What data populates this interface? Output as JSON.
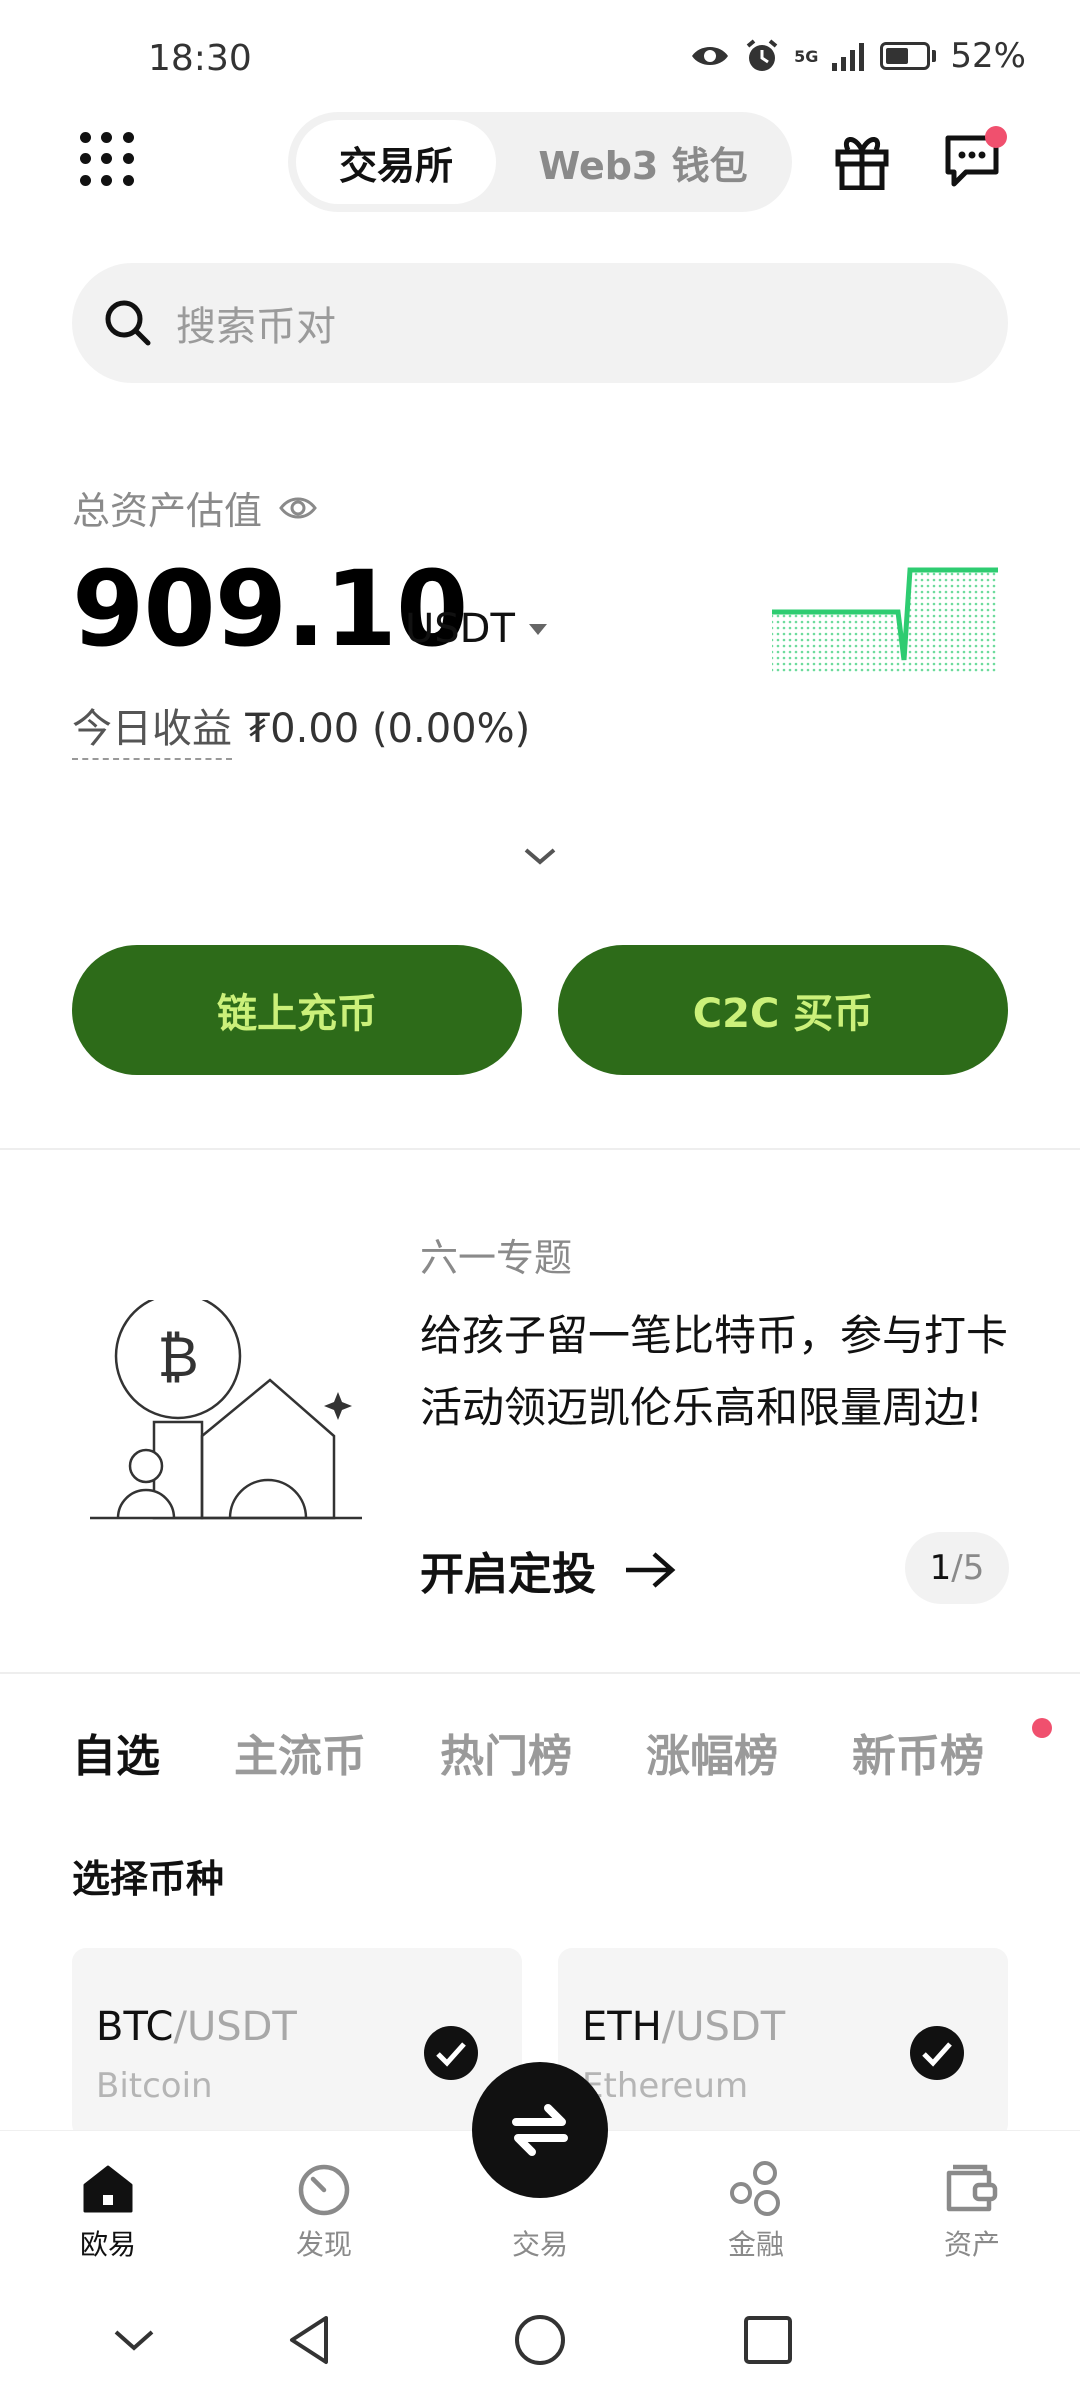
{
  "status_bar": {
    "time": "18:30",
    "network": "5G",
    "battery": "52%"
  },
  "header": {
    "tabs": [
      {
        "label": "交易所",
        "active": true
      },
      {
        "label": "Web3 钱包",
        "active": false
      }
    ],
    "icons": [
      "menu-grid-icon",
      "gift-icon",
      "message-icon"
    ]
  },
  "search": {
    "placeholder": "搜索币对"
  },
  "asset": {
    "label": "总资产估值",
    "value": "909.10",
    "unit": "USDT",
    "pnl_label": "今日收益",
    "pnl_value": "₮0.00 (0.00%)"
  },
  "actions": {
    "deposit": "链上充币",
    "c2c": "C2C 买币"
  },
  "promo": {
    "kicker": "六一专题",
    "title": "给孩子留一笔比特币，参与打卡活动领迈凯伦乐高和限量周边!",
    "cta": "开启定投",
    "page_current": "1",
    "page_total": "/5"
  },
  "market": {
    "tabs": [
      "自选",
      "主流币",
      "热门榜",
      "涨幅榜",
      "新币榜"
    ],
    "active_tab": "自选",
    "section_title": "选择币种",
    "coins": [
      {
        "base": "BTC",
        "quote": "/USDT",
        "name": "Bitcoin",
        "selected": true
      },
      {
        "base": "ETH",
        "quote": "/USDT",
        "name": "Ethereum",
        "selected": true
      }
    ]
  },
  "bottom_nav": [
    "欧易",
    "发现",
    "交易",
    "金融",
    "资产"
  ],
  "colors": {
    "accent_green": "#2d6b19",
    "accent_text": "#cbf07a",
    "badge_red": "#f0506e",
    "spark_green": "#2ecc71"
  }
}
